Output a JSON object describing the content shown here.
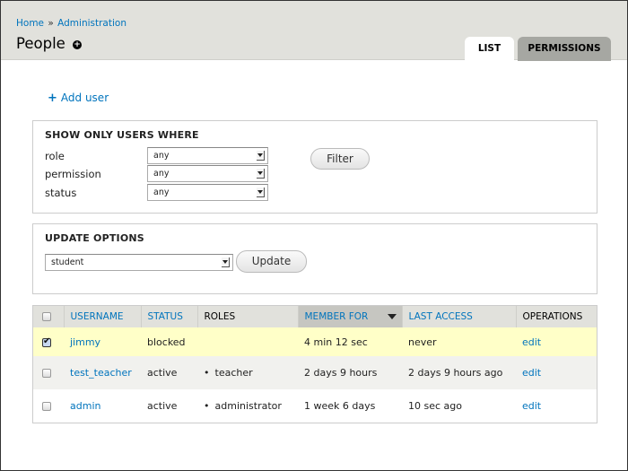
{
  "breadcrumb": {
    "items": [
      "Home",
      "Administration"
    ],
    "separator": "»"
  },
  "page": {
    "title": "People",
    "shortcut_icon": "add-shortcut-icon"
  },
  "tabs": [
    {
      "label": "LIST",
      "active": true
    },
    {
      "label": "PERMISSIONS",
      "active": false
    }
  ],
  "actions": {
    "add_user_icon": "plus-icon",
    "add_user_label": "Add user"
  },
  "filter": {
    "legend": "SHOW ONLY USERS WHERE",
    "fields": [
      {
        "label": "role",
        "value": "any"
      },
      {
        "label": "permission",
        "value": "any"
      },
      {
        "label": "status",
        "value": "any"
      }
    ],
    "button_label": "Filter"
  },
  "update": {
    "legend": "UPDATE OPTIONS",
    "select_value": "student",
    "button_label": "Update"
  },
  "table": {
    "columns": [
      {
        "label": "",
        "type": "checkbox"
      },
      {
        "label": "USERNAME",
        "link": true
      },
      {
        "label": "STATUS",
        "link": true
      },
      {
        "label": "ROLES",
        "link": false
      },
      {
        "label": "MEMBER FOR",
        "link": true,
        "sorted": "desc"
      },
      {
        "label": "LAST ACCESS",
        "link": true
      },
      {
        "label": "OPERATIONS",
        "link": false
      }
    ],
    "rows": [
      {
        "checked": true,
        "username": "jimmy",
        "status": "blocked",
        "roles": [],
        "member_for": "4 min 12 sec",
        "last_access": "never",
        "operation": "edit"
      },
      {
        "checked": false,
        "username": "test_teacher",
        "status": "active",
        "roles": [
          "teacher"
        ],
        "member_for": "2 days 9 hours",
        "last_access": "2 days 9 hours ago",
        "operation": "edit"
      },
      {
        "checked": false,
        "username": "admin",
        "status": "active",
        "roles": [
          "administrator"
        ],
        "member_for": "1 week 6 days",
        "last_access": "10 sec ago",
        "operation": "edit"
      }
    ]
  },
  "colors": {
    "link": "#0074bd",
    "header_bg": "#e1e1dc",
    "selected_row": "#ffffc8",
    "even_row": "#f1f1ee",
    "sorted_header": "#c6c6c1",
    "inactive_tab": "#a6a7a2"
  }
}
